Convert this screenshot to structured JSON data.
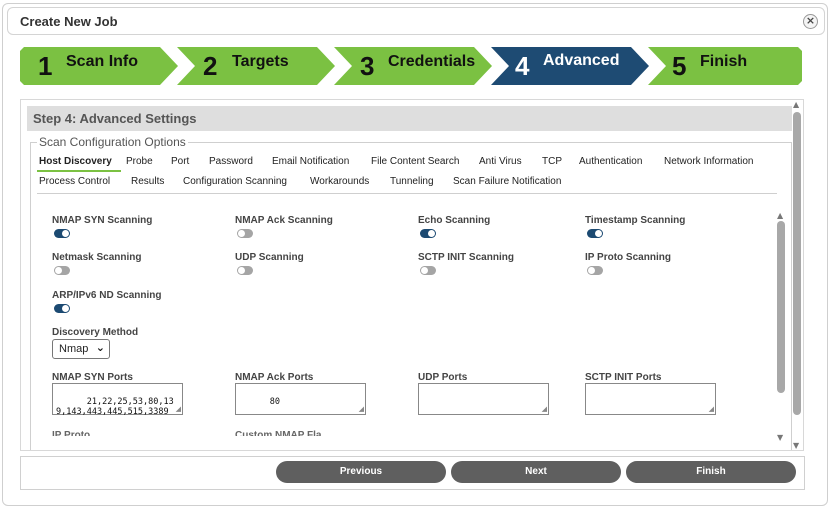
{
  "dialog": {
    "title": "Create New Job",
    "close_icon": "close-x-circle-icon"
  },
  "wizard": {
    "steps": [
      {
        "number": "1",
        "label": "Scan Info",
        "state": "complete"
      },
      {
        "number": "2",
        "label": "Targets",
        "state": "complete"
      },
      {
        "number": "3",
        "label": "Credentials",
        "state": "complete"
      },
      {
        "number": "4",
        "label": "Advanced",
        "state": "current"
      },
      {
        "number": "5",
        "label": "Finish",
        "state": "pending"
      }
    ],
    "colors": {
      "complete": "#7bc142",
      "current": "#1e4b73",
      "pending": "#7bc142"
    }
  },
  "step_title": "Step 4: Advanced Settings",
  "fieldset_legend": "Scan Configuration Options",
  "tabs": {
    "row1": [
      "Host Discovery",
      "Probe",
      "Port",
      "Password",
      "Email Notification",
      "File Content Search",
      "Anti Virus",
      "TCP",
      "Authentication",
      "Network Information"
    ],
    "row2": [
      "Process Control",
      "Results",
      "Configuration Scanning",
      "Workarounds",
      "Tunneling",
      "Scan Failure Notification"
    ],
    "active": "Host Discovery"
  },
  "options": [
    {
      "label": "NMAP SYN Scanning",
      "on": true
    },
    {
      "label": "NMAP Ack Scanning",
      "on": false
    },
    {
      "label": "Echo Scanning",
      "on": true
    },
    {
      "label": "Timestamp Scanning",
      "on": true
    },
    {
      "label": "Netmask Scanning",
      "on": false
    },
    {
      "label": "UDP Scanning",
      "on": false
    },
    {
      "label": "SCTP INIT Scanning",
      "on": false
    },
    {
      "label": "IP Proto Scanning",
      "on": false
    },
    {
      "label": "ARP/IPv6 ND Scanning",
      "on": true
    }
  ],
  "discovery": {
    "label": "Discovery Method",
    "selected": "Nmap"
  },
  "ports": [
    {
      "label": "NMAP SYN Ports",
      "value": "21,22,25,53,80,139,143,443,445,515,3389"
    },
    {
      "label": "NMAP Ack Ports",
      "value": "80"
    },
    {
      "label": "UDP Ports",
      "value": ""
    },
    {
      "label": "SCTP INIT Ports",
      "value": ""
    }
  ],
  "cut_labels": [
    "IP Proto...",
    "Custom NMAP Fla..."
  ],
  "buttons": {
    "previous": "Previous",
    "next": "Next",
    "finish": "Finish"
  },
  "colors": {
    "toggle_on": "#1c4a72",
    "toggle_off": "#a5a5a5",
    "button": "#5f5f5f",
    "tab_underline": "#7bc142"
  }
}
